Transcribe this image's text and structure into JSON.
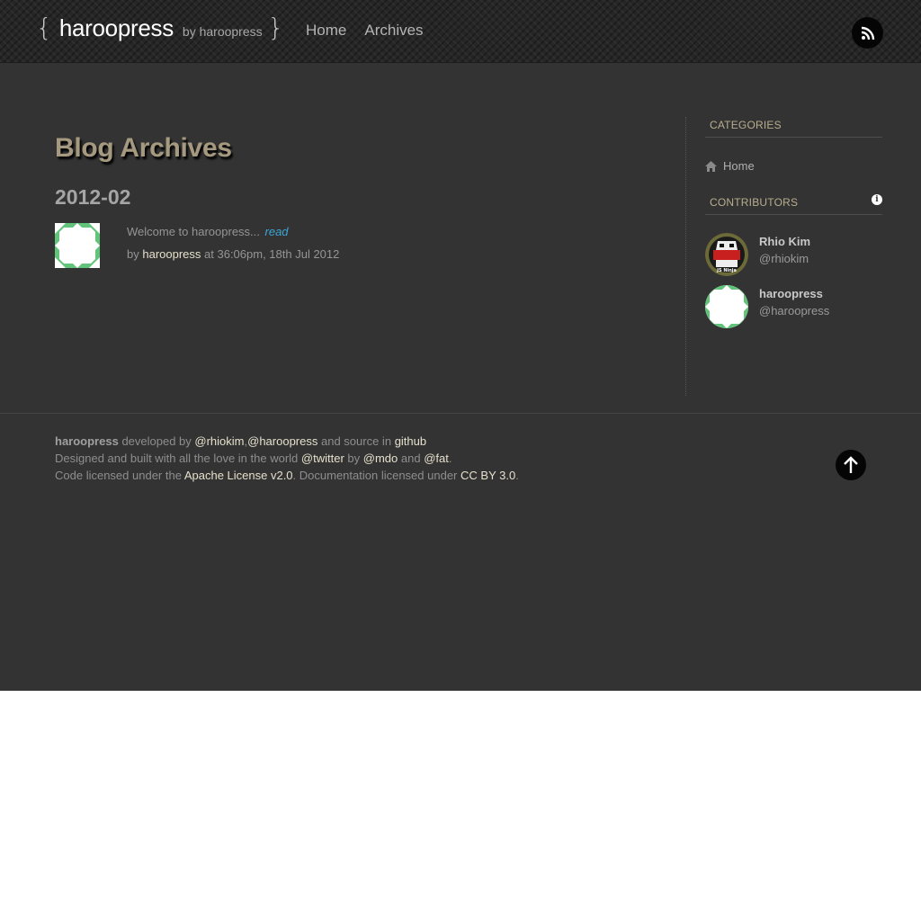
{
  "header": {
    "brand_open": "{",
    "brand_name": "haroopress",
    "brand_by": "by haroopress",
    "brand_close": "}",
    "nav": [
      "Home",
      "Archives"
    ],
    "rss_icon": "rss-icon"
  },
  "main": {
    "title": "Blog Archives",
    "year": "2012-02",
    "posts": [
      {
        "excerpt": "Welcome to haroopress...",
        "read_label": "read",
        "by": "by",
        "author": "haroopress",
        "date": "at 36:06pm, 18th Jul 2012"
      }
    ]
  },
  "sidebar": {
    "categories_heading": "CATEGORIES",
    "categories": [
      {
        "label": "Home",
        "icon": "home-icon"
      }
    ],
    "contributors_heading": "CONTRIBUTORS",
    "info_icon": "i",
    "contributors": [
      {
        "name": "Rhio Kim",
        "handle": "@rhiokim",
        "avatar_text": "JS Ninja"
      },
      {
        "name": "haroopress",
        "handle": "@haroopress"
      }
    ]
  },
  "footer": {
    "line1": {
      "brand": "haroopress",
      "developed_by": "developed by",
      "dev1": "@rhiokim",
      "sep": ",",
      "dev2": "@haroopress",
      "source_in": "and source in",
      "github": "github"
    },
    "line2": {
      "designed": "Designed and built with all the love in the world",
      "twitter": "@twitter",
      "by": "by",
      "mdo": "@mdo",
      "and": "and",
      "fat": "@fat",
      "end": "."
    },
    "line3": {
      "code_licensed": "Code licensed under the",
      "apache": "Apache License v2.0",
      "doc_licensed": ". Documentation licensed under",
      "cc": "CC BY 3.0",
      "end": "."
    },
    "top_icon": "arrow-up-icon"
  },
  "colors": {
    "background": "#333333",
    "navbar": "#262626",
    "title": "#a59a80",
    "link": "#e6e0cc",
    "read_link": "#3ba6d6",
    "heading": "#b8ad8e"
  }
}
